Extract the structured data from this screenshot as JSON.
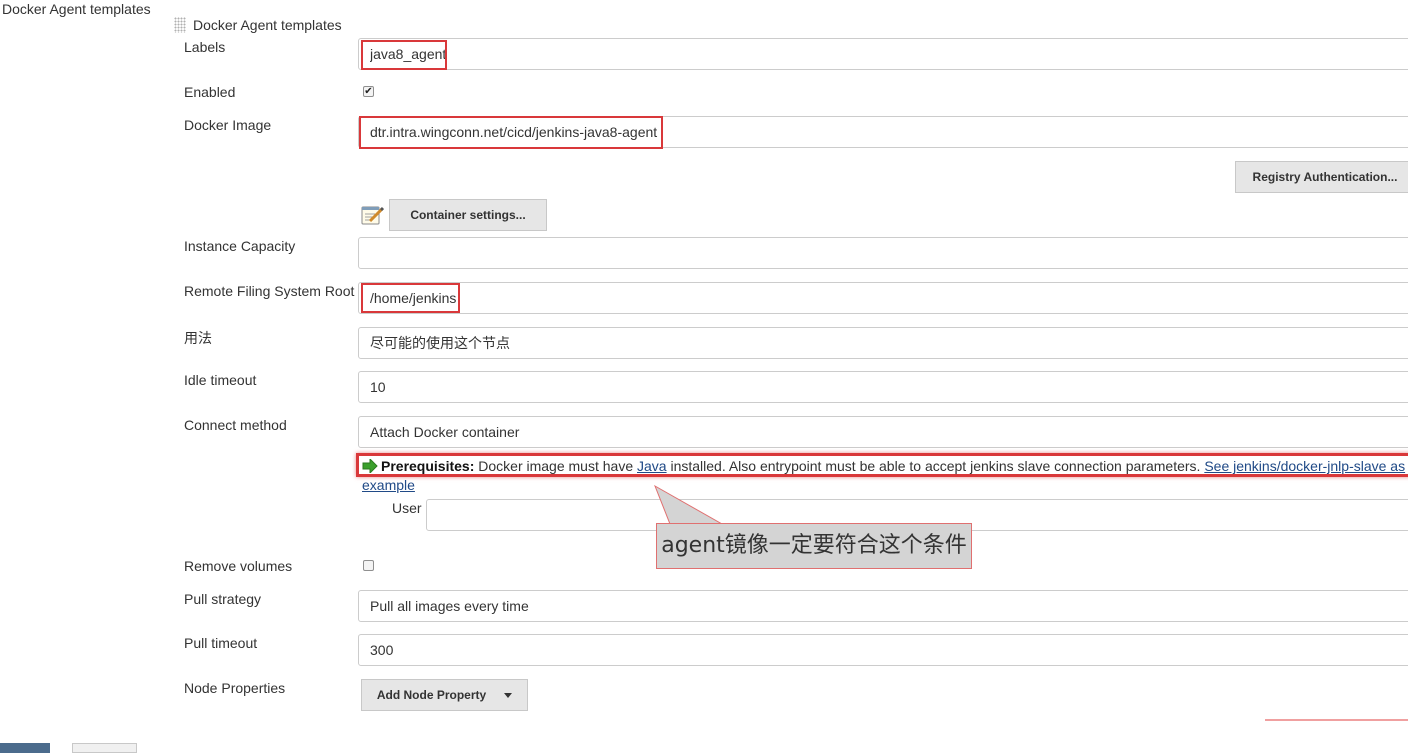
{
  "section": {
    "title": "Docker Agent templates"
  },
  "template": {
    "title": "Docker Agent templates",
    "fields": {
      "labels": {
        "label": "Labels",
        "value": "java8_agent"
      },
      "enabled": {
        "label": "Enabled",
        "checked": true
      },
      "docker_image": {
        "label": "Docker Image",
        "value": "dtr.intra.wingconn.net/cicd/jenkins-java8-agent"
      },
      "instance_capacity": {
        "label": "Instance Capacity",
        "value": ""
      },
      "remote_fs_root": {
        "label": "Remote Filing System Root",
        "value": "/home/jenkins"
      },
      "usage": {
        "label": "用法",
        "value": "尽可能的使用这个节点"
      },
      "idle_timeout": {
        "label": "Idle timeout",
        "value": "10"
      },
      "connect_method": {
        "label": "Connect method",
        "value": "Attach Docker container"
      },
      "user": {
        "label": "User",
        "value": ""
      },
      "remove_volumes": {
        "label": "Remove volumes",
        "checked": false
      },
      "pull_strategy": {
        "label": "Pull strategy",
        "value": "Pull all images every time"
      },
      "pull_timeout": {
        "label": "Pull timeout",
        "value": "300"
      },
      "node_properties": {
        "label": "Node Properties"
      }
    },
    "buttons": {
      "registry_auth": "Registry Authentication...",
      "container_settings": "Container settings...",
      "add_node_property": "Add Node Property"
    },
    "prerequisites": {
      "heading": "Prerequisites:",
      "text_before_link": " Docker image must have ",
      "java_link": "Java",
      "text_after_link": " installed. Also entrypoint must be able to accept jenkins slave connection parameters. ",
      "see_link": "See jenkins/docker-jnlp-slave as",
      "example_link": "example"
    }
  },
  "annotation": {
    "callout_text": "agent镜像一定要符合这个条件"
  },
  "icons": {
    "notepad": "notepad-icon",
    "arrow": "green-arrow-icon",
    "handle": "drag-handle-icon",
    "dropdown": "chevron-down-icon"
  },
  "colors": {
    "highlight": "#d9383a",
    "arrow": "#3aa02c",
    "link": "#204a87"
  }
}
